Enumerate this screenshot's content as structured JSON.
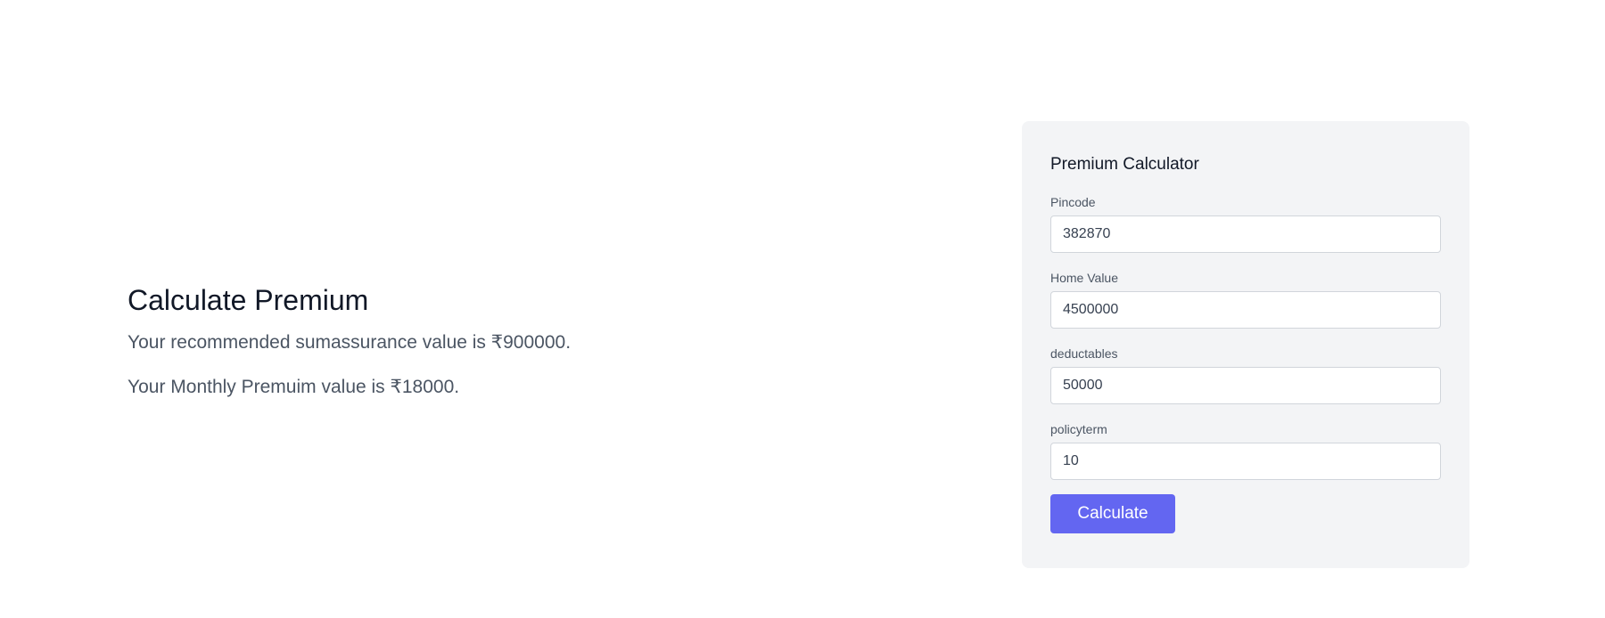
{
  "result": {
    "heading": "Calculate Premium",
    "sum_assurance_text": "Your recommended sumassurance value is ₹900000.",
    "monthly_premium_text": "Your Monthly Premuim value is ₹18000."
  },
  "calculator": {
    "title": "Premium Calculator",
    "fields": [
      {
        "label": "Pincode",
        "value": "382870"
      },
      {
        "label": "Home Value",
        "value": "4500000"
      },
      {
        "label": "deductables",
        "value": "50000"
      },
      {
        "label": "policyterm",
        "value": "10"
      }
    ],
    "button_label": "Calculate"
  },
  "colors": {
    "accent": "#6366f1",
    "card_background": "#f3f4f6"
  }
}
